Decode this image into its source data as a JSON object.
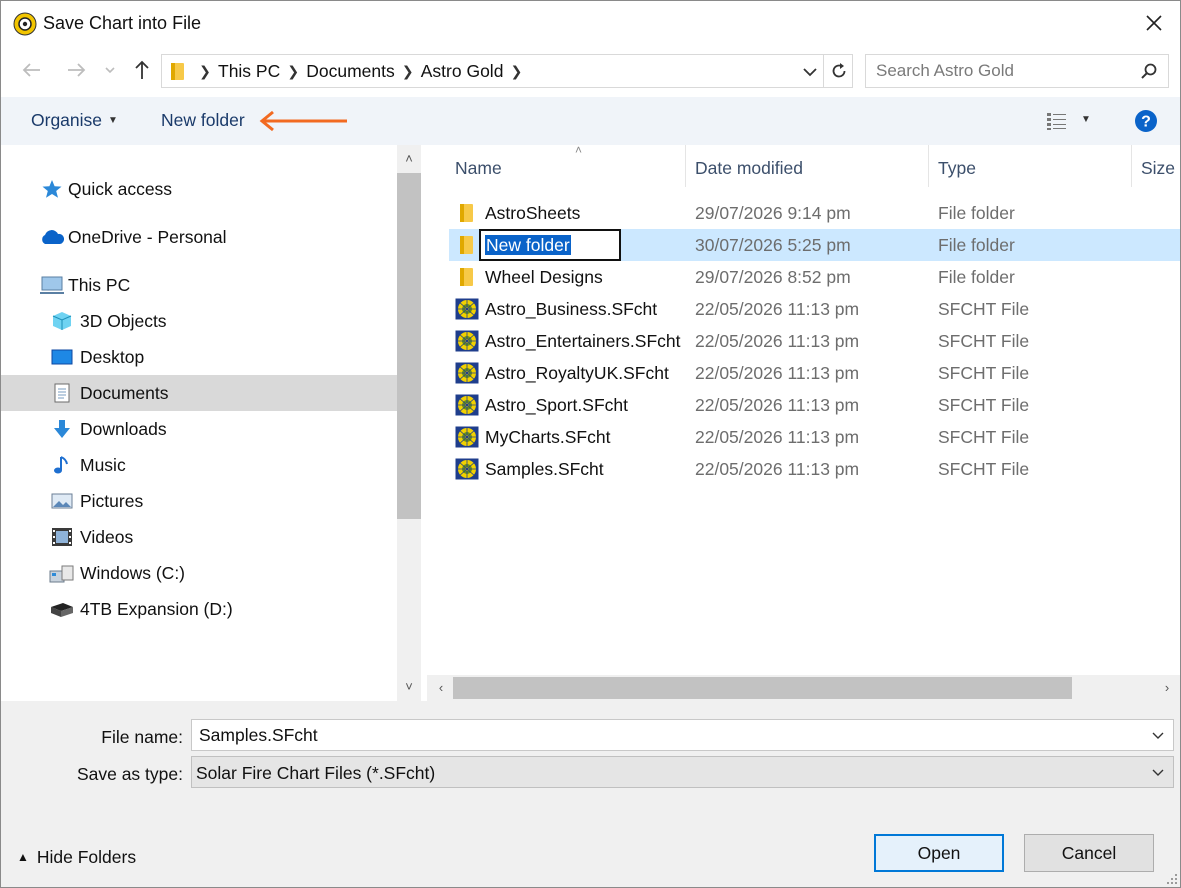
{
  "window": {
    "title": "Save Chart into File"
  },
  "address": {
    "crumbs": [
      "This PC",
      "Documents",
      "Astro Gold"
    ],
    "search_placeholder": "Search Astro Gold"
  },
  "toolbar": {
    "organise_label": "Organise",
    "new_folder_label": "New folder"
  },
  "nav": {
    "quick_access": "Quick access",
    "onedrive": "OneDrive - Personal",
    "this_pc": "This PC",
    "items": [
      "3D Objects",
      "Desktop",
      "Documents",
      "Downloads",
      "Music",
      "Pictures",
      "Videos",
      "Windows (C:)",
      "4TB Expansion (D:)"
    ],
    "selected": "Documents"
  },
  "columns": {
    "name": "Name",
    "date": "Date modified",
    "type": "Type",
    "size": "Size"
  },
  "files": [
    {
      "name": "AstroSheets",
      "date": "29/07/2026 9:14 pm",
      "type": "File folder",
      "icon": "folder-icon"
    },
    {
      "name": "New folder",
      "date": "30/07/2026 5:25 pm",
      "type": "File folder",
      "icon": "folder-icon",
      "renaming": true
    },
    {
      "name": "Wheel Designs",
      "date": "29/07/2026 8:52 pm",
      "type": "File folder",
      "icon": "folder-icon"
    },
    {
      "name": "Astro_Business.SFcht",
      "date": "22/05/2026 11:13 pm",
      "type": "SFCHT File",
      "icon": "sfcht-file-icon"
    },
    {
      "name": "Astro_Entertainers.SFcht",
      "date": "22/05/2026 11:13 pm",
      "type": "SFCHT File",
      "icon": "sfcht-file-icon"
    },
    {
      "name": "Astro_RoyaltyUK.SFcht",
      "date": "22/05/2026 11:13 pm",
      "type": "SFCHT File",
      "icon": "sfcht-file-icon"
    },
    {
      "name": "Astro_Sport.SFcht",
      "date": "22/05/2026 11:13 pm",
      "type": "SFCHT File",
      "icon": "sfcht-file-icon"
    },
    {
      "name": "MyCharts.SFcht",
      "date": "22/05/2026 11:13 pm",
      "type": "SFCHT File",
      "icon": "sfcht-file-icon"
    },
    {
      "name": "Samples.SFcht",
      "date": "22/05/2026 11:13 pm",
      "type": "SFCHT File",
      "icon": "sfcht-file-icon"
    }
  ],
  "form": {
    "file_name_label": "File name:",
    "file_name_value": "Samples.SFcht",
    "save_type_label": "Save as type:",
    "save_type_value": "Solar Fire Chart Files (*.SFcht)"
  },
  "footer": {
    "hide_folders": "Hide Folders",
    "open": "Open",
    "cancel": "Cancel"
  },
  "colors": {
    "accent": "#0078d7",
    "selection": "#cce8ff",
    "annotation_arrow": "#f26a21",
    "folder": "#f7c948"
  }
}
